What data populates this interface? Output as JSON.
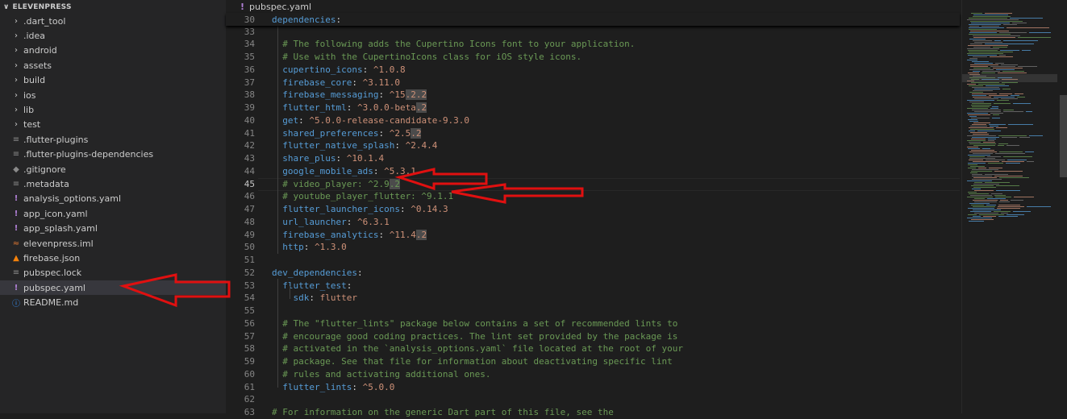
{
  "explorer": {
    "project": "ELEVENPRESS",
    "items": [
      {
        "label": ".dart_tool",
        "icon": "chevron-right-icon",
        "type": "folder"
      },
      {
        "label": ".idea",
        "icon": "chevron-right-icon",
        "type": "folder"
      },
      {
        "label": "android",
        "icon": "chevron-right-icon",
        "type": "folder"
      },
      {
        "label": "assets",
        "icon": "chevron-right-icon",
        "type": "folder"
      },
      {
        "label": "build",
        "icon": "chevron-right-icon",
        "type": "folder"
      },
      {
        "label": "ios",
        "icon": "chevron-right-icon",
        "type": "folder"
      },
      {
        "label": "lib",
        "icon": "chevron-right-icon",
        "type": "folder"
      },
      {
        "label": "test",
        "icon": "chevron-right-icon",
        "type": "folder"
      },
      {
        "label": ".flutter-plugins",
        "icon": "file-icon",
        "type": "file"
      },
      {
        "label": ".flutter-plugins-dependencies",
        "icon": "file-icon",
        "type": "file"
      },
      {
        "label": ".gitignore",
        "icon": "git-icon",
        "type": "file"
      },
      {
        "label": ".metadata",
        "icon": "file-icon",
        "type": "file"
      },
      {
        "label": "analysis_options.yaml",
        "icon": "yaml-icon",
        "type": "file"
      },
      {
        "label": "app_icon.yaml",
        "icon": "yaml-icon",
        "type": "file"
      },
      {
        "label": "app_splash.yaml",
        "icon": "yaml-icon",
        "type": "file"
      },
      {
        "label": "elevenpress.iml",
        "icon": "xml-icon",
        "type": "file"
      },
      {
        "label": "firebase.json",
        "icon": "firebase-icon",
        "type": "file"
      },
      {
        "label": "pubspec.lock",
        "icon": "file-icon",
        "type": "file"
      },
      {
        "label": "pubspec.yaml",
        "icon": "yaml-icon",
        "type": "file",
        "selected": true
      },
      {
        "label": "README.md",
        "icon": "info-icon",
        "type": "file"
      }
    ]
  },
  "editor": {
    "tab_title": "pubspec.yaml",
    "sticky": {
      "num": "30",
      "key": "dependencies",
      "punct": ":"
    },
    "lines": [
      {
        "n": "33",
        "parts": []
      },
      {
        "n": "34",
        "parts": [
          {
            "t": "  # The following adds the Cupertino Icons font to your application.",
            "c": "c"
          }
        ]
      },
      {
        "n": "35",
        "parts": [
          {
            "t": "  # Use with the CupertinoIcons class for iOS style icons.",
            "c": "c"
          }
        ]
      },
      {
        "n": "36",
        "parts": [
          {
            "t": "  cupertino_icons",
            "c": "k"
          },
          {
            "t": ": ",
            "c": "p"
          },
          {
            "t": "^1.0.8",
            "c": "s"
          }
        ]
      },
      {
        "n": "37",
        "parts": [
          {
            "t": "  firebase_core",
            "c": "k"
          },
          {
            "t": ": ",
            "c": "p"
          },
          {
            "t": "^3.11.0",
            "c": "s"
          }
        ]
      },
      {
        "n": "38",
        "parts": [
          {
            "t": "  firebase_messaging",
            "c": "k"
          },
          {
            "t": ": ",
            "c": "p"
          },
          {
            "t": "^15",
            "c": "s"
          },
          {
            "t": ".2.2",
            "c": "s hl"
          }
        ]
      },
      {
        "n": "39",
        "parts": [
          {
            "t": "  flutter_html",
            "c": "k"
          },
          {
            "t": ": ",
            "c": "p"
          },
          {
            "t": "^3.0.0-beta",
            "c": "s"
          },
          {
            "t": ".2",
            "c": "s hl"
          }
        ]
      },
      {
        "n": "40",
        "parts": [
          {
            "t": "  get",
            "c": "k"
          },
          {
            "t": ": ",
            "c": "p"
          },
          {
            "t": "^5.0.0-release-candidate-9.3.0",
            "c": "s"
          }
        ]
      },
      {
        "n": "41",
        "parts": [
          {
            "t": "  shared_preferences",
            "c": "k"
          },
          {
            "t": ": ",
            "c": "p"
          },
          {
            "t": "^2.5",
            "c": "s"
          },
          {
            "t": ".2",
            "c": "s hl"
          }
        ]
      },
      {
        "n": "42",
        "parts": [
          {
            "t": "  flutter_native_splash",
            "c": "k"
          },
          {
            "t": ": ",
            "c": "p"
          },
          {
            "t": "^2.4.4",
            "c": "s"
          }
        ]
      },
      {
        "n": "43",
        "parts": [
          {
            "t": "  share_plus",
            "c": "k"
          },
          {
            "t": ": ",
            "c": "p"
          },
          {
            "t": "^10.1.4",
            "c": "s"
          }
        ]
      },
      {
        "n": "44",
        "parts": [
          {
            "t": "  google_mobile_ads",
            "c": "k"
          },
          {
            "t": ": ",
            "c": "p"
          },
          {
            "t": "^5.3.1",
            "c": "s"
          }
        ]
      },
      {
        "n": "45",
        "active": true,
        "parts": [
          {
            "t": "  # video_player: ^2.9",
            "c": "c"
          },
          {
            "t": ".2",
            "c": "c hl"
          }
        ]
      },
      {
        "n": "46",
        "parts": [
          {
            "t": "  # youtube_player_flutter: ^9.1.1",
            "c": "c"
          }
        ]
      },
      {
        "n": "47",
        "parts": [
          {
            "t": "  flutter_launcher_icons",
            "c": "k"
          },
          {
            "t": ": ",
            "c": "p"
          },
          {
            "t": "^0.14.3",
            "c": "s"
          }
        ]
      },
      {
        "n": "48",
        "parts": [
          {
            "t": "  url_launcher",
            "c": "k"
          },
          {
            "t": ": ",
            "c": "p"
          },
          {
            "t": "^6.3.1",
            "c": "s"
          }
        ]
      },
      {
        "n": "49",
        "parts": [
          {
            "t": "  firebase_analytics",
            "c": "k"
          },
          {
            "t": ": ",
            "c": "p"
          },
          {
            "t": "^11.4",
            "c": "s"
          },
          {
            "t": ".2",
            "c": "s hl"
          }
        ]
      },
      {
        "n": "50",
        "parts": [
          {
            "t": "  http",
            "c": "k"
          },
          {
            "t": ": ",
            "c": "p"
          },
          {
            "t": "^1.3.0",
            "c": "s"
          }
        ]
      },
      {
        "n": "51",
        "parts": []
      },
      {
        "n": "52",
        "parts": [
          {
            "t": "dev_dependencies",
            "c": "k"
          },
          {
            "t": ":",
            "c": "p"
          }
        ]
      },
      {
        "n": "53",
        "parts": [
          {
            "t": "  flutter_test",
            "c": "k"
          },
          {
            "t": ":",
            "c": "p"
          }
        ]
      },
      {
        "n": "54",
        "parts": [
          {
            "t": "    sdk",
            "c": "k"
          },
          {
            "t": ": ",
            "c": "p"
          },
          {
            "t": "flutter",
            "c": "s"
          }
        ]
      },
      {
        "n": "55",
        "parts": []
      },
      {
        "n": "56",
        "parts": [
          {
            "t": "  # The \"flutter_lints\" package below contains a set of recommended lints to",
            "c": "c"
          }
        ]
      },
      {
        "n": "57",
        "parts": [
          {
            "t": "  # encourage good coding practices. The lint set provided by the package is",
            "c": "c"
          }
        ]
      },
      {
        "n": "58",
        "parts": [
          {
            "t": "  # activated in the `analysis_options.yaml` file located at the root of your",
            "c": "c"
          }
        ]
      },
      {
        "n": "59",
        "parts": [
          {
            "t": "  # package. See that file for information about deactivating specific lint",
            "c": "c"
          }
        ]
      },
      {
        "n": "60",
        "parts": [
          {
            "t": "  # rules and activating additional ones.",
            "c": "c"
          }
        ]
      },
      {
        "n": "61",
        "parts": [
          {
            "t": "  flutter_lints",
            "c": "k"
          },
          {
            "t": ": ",
            "c": "p"
          },
          {
            "t": "^5.0.0",
            "c": "s"
          }
        ]
      },
      {
        "n": "62",
        "parts": []
      },
      {
        "n": "63",
        "parts": [
          {
            "t": "# For information on the generic Dart part of this file, see the",
            "c": "c"
          }
        ]
      }
    ]
  },
  "colors": {
    "annotation_arrow": "#e01010",
    "key": "#569cd6",
    "string": "#ce9178",
    "comment": "#6a9955"
  }
}
